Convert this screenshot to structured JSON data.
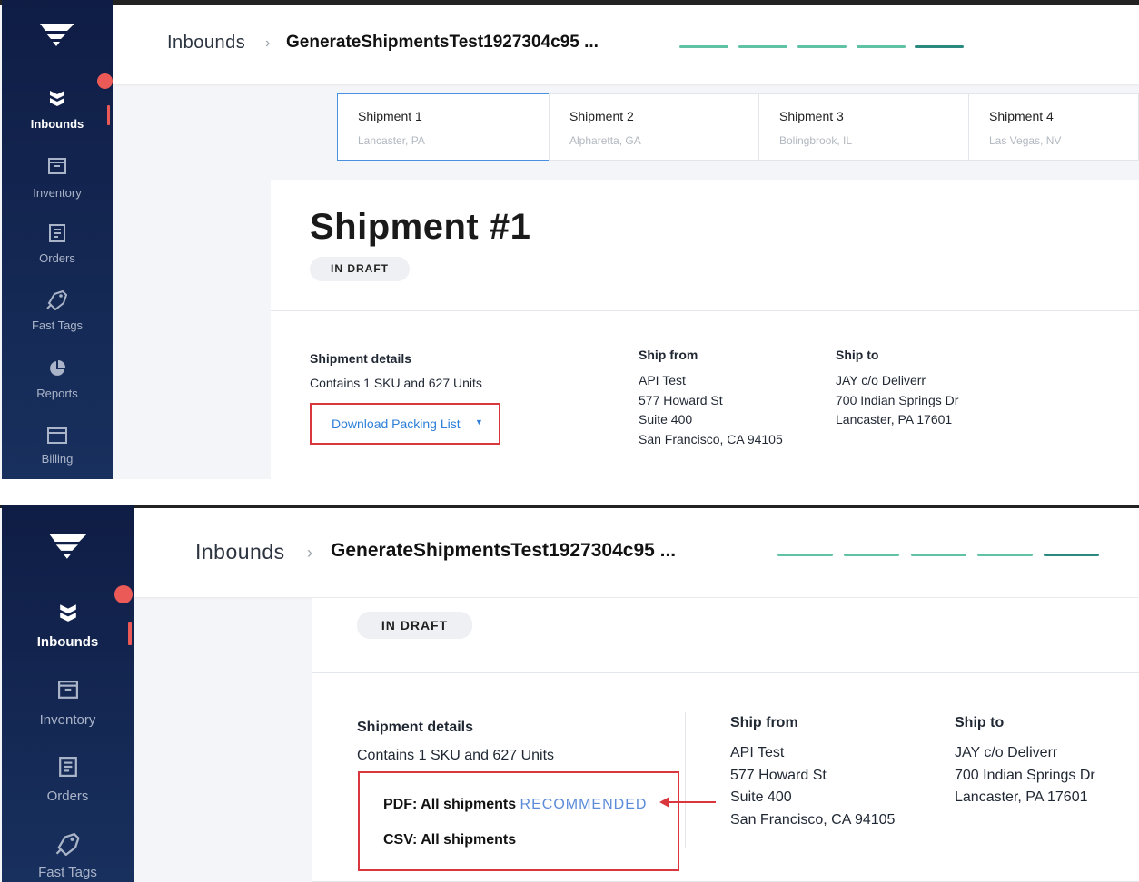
{
  "sidebar": {
    "items": [
      {
        "label": "Inbounds",
        "icon": "inbounds-icon",
        "active": true
      },
      {
        "label": "Inventory",
        "icon": "inventory-icon"
      },
      {
        "label": "Orders",
        "icon": "orders-icon"
      },
      {
        "label": "Fast Tags",
        "icon": "fast-tags-icon"
      },
      {
        "label": "Reports",
        "icon": "reports-icon"
      },
      {
        "label": "Billing",
        "icon": "billing-icon"
      }
    ]
  },
  "header": {
    "breadcrumb": "Inbounds",
    "separator": "›",
    "title": "GenerateShipmentsTest1927304c95 ..."
  },
  "tabs": [
    {
      "name": "Shipment 1",
      "city": "Lancaster, PA"
    },
    {
      "name": "Shipment 2",
      "city": "Alpharetta, GA"
    },
    {
      "name": "Shipment 3",
      "city": "Bolingbrook, IL"
    },
    {
      "name": "Shipment 4",
      "city": "Las Vegas, NV"
    }
  ],
  "shipment": {
    "title": "Shipment #1",
    "status": "IN DRAFT",
    "details_label": "Shipment details",
    "details_text": "Contains 1 SKU and 627 Units",
    "download_label": "Download Packing List",
    "ship_from": {
      "label": "Ship from",
      "lines": [
        "API Test",
        "577 Howard St",
        "Suite 400",
        "San Francisco, CA 94105"
      ]
    },
    "ship_to": {
      "label": "Ship to",
      "lines": [
        "JAY c/o Deliverr",
        "700 Indian Springs Dr",
        "Lancaster, PA 17601"
      ]
    }
  },
  "dropdown": {
    "pdf_label": "PDF: All shipments",
    "recommended": "RECOMMENDED",
    "csv_label": "CSV: All shipments"
  },
  "colors": {
    "accent": "#4a90e2",
    "highlight": "#d9363e",
    "progress": "#5fc2a5",
    "sidebar": "#0f1d45"
  }
}
